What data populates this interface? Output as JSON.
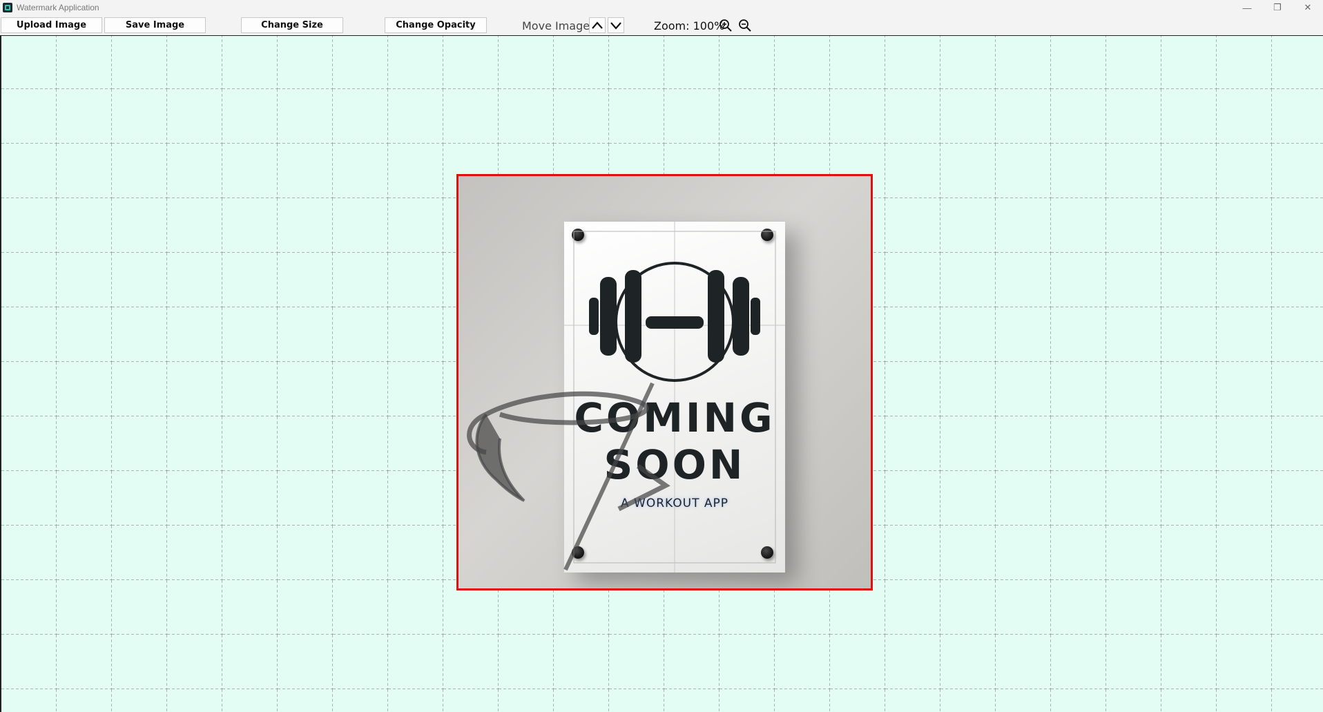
{
  "window": {
    "title": "Watermark Application",
    "minimize": "—",
    "restore": "❐",
    "close": "✕"
  },
  "toolbar": {
    "upload_label": "Upload Image",
    "save_label": "Save Image",
    "change_size_label": "Change Size",
    "change_opacity_label": "Change Opacity",
    "move_label": "Move Image:",
    "zoom_label": "Zoom: 100%"
  },
  "icons": {
    "app": "app-logo-icon",
    "move_up": "chevron-up-icon",
    "move_down": "chevron-down-icon",
    "zoom_in": "zoom-in-icon",
    "zoom_out": "zoom-out-icon"
  },
  "image": {
    "poster_line1": "COMING",
    "poster_line2": "SOON",
    "poster_sub": "A WORKOUT APP",
    "selection_color": "#e01010"
  },
  "colors": {
    "canvas_bg": "#e4fdf4",
    "toolbar_bg": "#f3f3f3"
  }
}
